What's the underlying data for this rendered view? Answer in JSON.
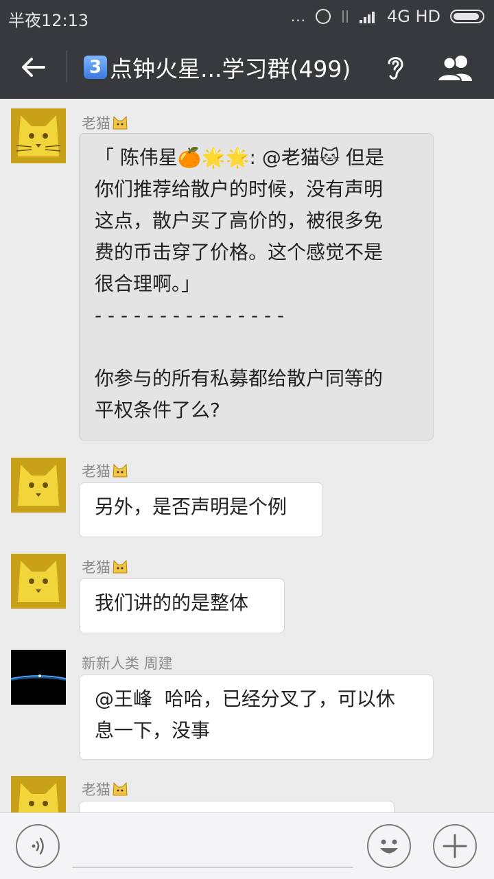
{
  "status_bar": {
    "time": "半夜12:13",
    "dots": "...",
    "network": "4G HD"
  },
  "header": {
    "keycap": "3",
    "title": "点钟火星...学习群(499)"
  },
  "messages": [
    {
      "sender": "老猫",
      "text": "「 陈伟星🍊🌟🌟: @老猫🐱 但是\n你们推荐给散户的时候，没有声明\n这点，散户买了高价的，被很多免\n费的币击穿了价格。这个感觉不是\n很合理啊。」\n- - - - - - - - - - - - - - -\n\n你参与的所有私募都给散户同等的\n平权条件了么?"
    },
    {
      "sender": "老猫",
      "text": "另外，是否声明是个例"
    },
    {
      "sender": "老猫",
      "text": "我们讲的的是整体"
    },
    {
      "sender": "新新人类  周建",
      "text": "@王峰  哈哈，已经分叉了，可以休\n息一下，没事"
    },
    {
      "sender": "老猫",
      "text": ""
    }
  ],
  "colors": {
    "bar_bg": "#38393d",
    "chat_bg": "#ebebeb",
    "avatar_gold": "#c8a118"
  }
}
